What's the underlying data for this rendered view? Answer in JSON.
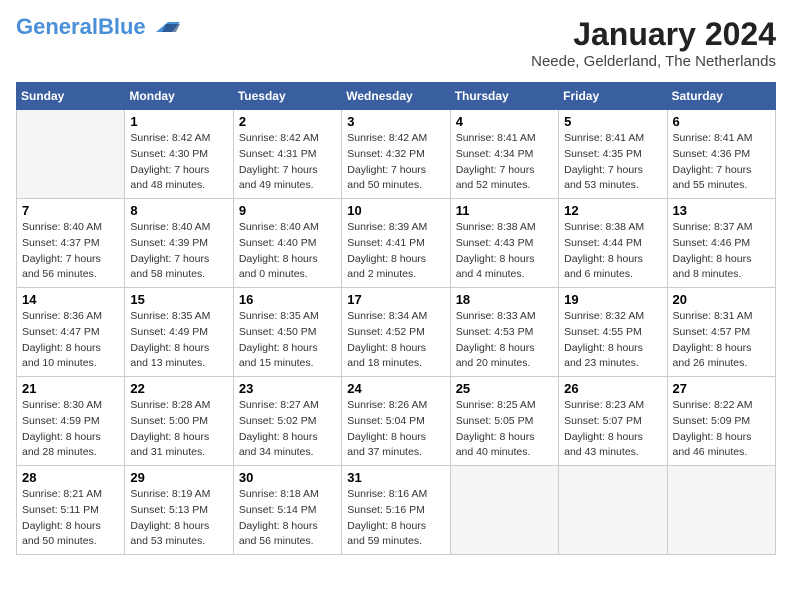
{
  "header": {
    "logo_general": "General",
    "logo_blue": "Blue",
    "month": "January 2024",
    "location": "Neede, Gelderland, The Netherlands"
  },
  "days_of_week": [
    "Sunday",
    "Monday",
    "Tuesday",
    "Wednesday",
    "Thursday",
    "Friday",
    "Saturday"
  ],
  "weeks": [
    [
      {
        "day": "",
        "sunrise": "",
        "sunset": "",
        "daylight": ""
      },
      {
        "day": "1",
        "sunrise": "Sunrise: 8:42 AM",
        "sunset": "Sunset: 4:30 PM",
        "daylight": "Daylight: 7 hours and 48 minutes."
      },
      {
        "day": "2",
        "sunrise": "Sunrise: 8:42 AM",
        "sunset": "Sunset: 4:31 PM",
        "daylight": "Daylight: 7 hours and 49 minutes."
      },
      {
        "day": "3",
        "sunrise": "Sunrise: 8:42 AM",
        "sunset": "Sunset: 4:32 PM",
        "daylight": "Daylight: 7 hours and 50 minutes."
      },
      {
        "day": "4",
        "sunrise": "Sunrise: 8:41 AM",
        "sunset": "Sunset: 4:34 PM",
        "daylight": "Daylight: 7 hours and 52 minutes."
      },
      {
        "day": "5",
        "sunrise": "Sunrise: 8:41 AM",
        "sunset": "Sunset: 4:35 PM",
        "daylight": "Daylight: 7 hours and 53 minutes."
      },
      {
        "day": "6",
        "sunrise": "Sunrise: 8:41 AM",
        "sunset": "Sunset: 4:36 PM",
        "daylight": "Daylight: 7 hours and 55 minutes."
      }
    ],
    [
      {
        "day": "7",
        "sunrise": "Sunrise: 8:40 AM",
        "sunset": "Sunset: 4:37 PM",
        "daylight": "Daylight: 7 hours and 56 minutes."
      },
      {
        "day": "8",
        "sunrise": "Sunrise: 8:40 AM",
        "sunset": "Sunset: 4:39 PM",
        "daylight": "Daylight: 7 hours and 58 minutes."
      },
      {
        "day": "9",
        "sunrise": "Sunrise: 8:40 AM",
        "sunset": "Sunset: 4:40 PM",
        "daylight": "Daylight: 8 hours and 0 minutes."
      },
      {
        "day": "10",
        "sunrise": "Sunrise: 8:39 AM",
        "sunset": "Sunset: 4:41 PM",
        "daylight": "Daylight: 8 hours and 2 minutes."
      },
      {
        "day": "11",
        "sunrise": "Sunrise: 8:38 AM",
        "sunset": "Sunset: 4:43 PM",
        "daylight": "Daylight: 8 hours and 4 minutes."
      },
      {
        "day": "12",
        "sunrise": "Sunrise: 8:38 AM",
        "sunset": "Sunset: 4:44 PM",
        "daylight": "Daylight: 8 hours and 6 minutes."
      },
      {
        "day": "13",
        "sunrise": "Sunrise: 8:37 AM",
        "sunset": "Sunset: 4:46 PM",
        "daylight": "Daylight: 8 hours and 8 minutes."
      }
    ],
    [
      {
        "day": "14",
        "sunrise": "Sunrise: 8:36 AM",
        "sunset": "Sunset: 4:47 PM",
        "daylight": "Daylight: 8 hours and 10 minutes."
      },
      {
        "day": "15",
        "sunrise": "Sunrise: 8:35 AM",
        "sunset": "Sunset: 4:49 PM",
        "daylight": "Daylight: 8 hours and 13 minutes."
      },
      {
        "day": "16",
        "sunrise": "Sunrise: 8:35 AM",
        "sunset": "Sunset: 4:50 PM",
        "daylight": "Daylight: 8 hours and 15 minutes."
      },
      {
        "day": "17",
        "sunrise": "Sunrise: 8:34 AM",
        "sunset": "Sunset: 4:52 PM",
        "daylight": "Daylight: 8 hours and 18 minutes."
      },
      {
        "day": "18",
        "sunrise": "Sunrise: 8:33 AM",
        "sunset": "Sunset: 4:53 PM",
        "daylight": "Daylight: 8 hours and 20 minutes."
      },
      {
        "day": "19",
        "sunrise": "Sunrise: 8:32 AM",
        "sunset": "Sunset: 4:55 PM",
        "daylight": "Daylight: 8 hours and 23 minutes."
      },
      {
        "day": "20",
        "sunrise": "Sunrise: 8:31 AM",
        "sunset": "Sunset: 4:57 PM",
        "daylight": "Daylight: 8 hours and 26 minutes."
      }
    ],
    [
      {
        "day": "21",
        "sunrise": "Sunrise: 8:30 AM",
        "sunset": "Sunset: 4:59 PM",
        "daylight": "Daylight: 8 hours and 28 minutes."
      },
      {
        "day": "22",
        "sunrise": "Sunrise: 8:28 AM",
        "sunset": "Sunset: 5:00 PM",
        "daylight": "Daylight: 8 hours and 31 minutes."
      },
      {
        "day": "23",
        "sunrise": "Sunrise: 8:27 AM",
        "sunset": "Sunset: 5:02 PM",
        "daylight": "Daylight: 8 hours and 34 minutes."
      },
      {
        "day": "24",
        "sunrise": "Sunrise: 8:26 AM",
        "sunset": "Sunset: 5:04 PM",
        "daylight": "Daylight: 8 hours and 37 minutes."
      },
      {
        "day": "25",
        "sunrise": "Sunrise: 8:25 AM",
        "sunset": "Sunset: 5:05 PM",
        "daylight": "Daylight: 8 hours and 40 minutes."
      },
      {
        "day": "26",
        "sunrise": "Sunrise: 8:23 AM",
        "sunset": "Sunset: 5:07 PM",
        "daylight": "Daylight: 8 hours and 43 minutes."
      },
      {
        "day": "27",
        "sunrise": "Sunrise: 8:22 AM",
        "sunset": "Sunset: 5:09 PM",
        "daylight": "Daylight: 8 hours and 46 minutes."
      }
    ],
    [
      {
        "day": "28",
        "sunrise": "Sunrise: 8:21 AM",
        "sunset": "Sunset: 5:11 PM",
        "daylight": "Daylight: 8 hours and 50 minutes."
      },
      {
        "day": "29",
        "sunrise": "Sunrise: 8:19 AM",
        "sunset": "Sunset: 5:13 PM",
        "daylight": "Daylight: 8 hours and 53 minutes."
      },
      {
        "day": "30",
        "sunrise": "Sunrise: 8:18 AM",
        "sunset": "Sunset: 5:14 PM",
        "daylight": "Daylight: 8 hours and 56 minutes."
      },
      {
        "day": "31",
        "sunrise": "Sunrise: 8:16 AM",
        "sunset": "Sunset: 5:16 PM",
        "daylight": "Daylight: 8 hours and 59 minutes."
      },
      {
        "day": "",
        "sunrise": "",
        "sunset": "",
        "daylight": ""
      },
      {
        "day": "",
        "sunrise": "",
        "sunset": "",
        "daylight": ""
      },
      {
        "day": "",
        "sunrise": "",
        "sunset": "",
        "daylight": ""
      }
    ]
  ]
}
